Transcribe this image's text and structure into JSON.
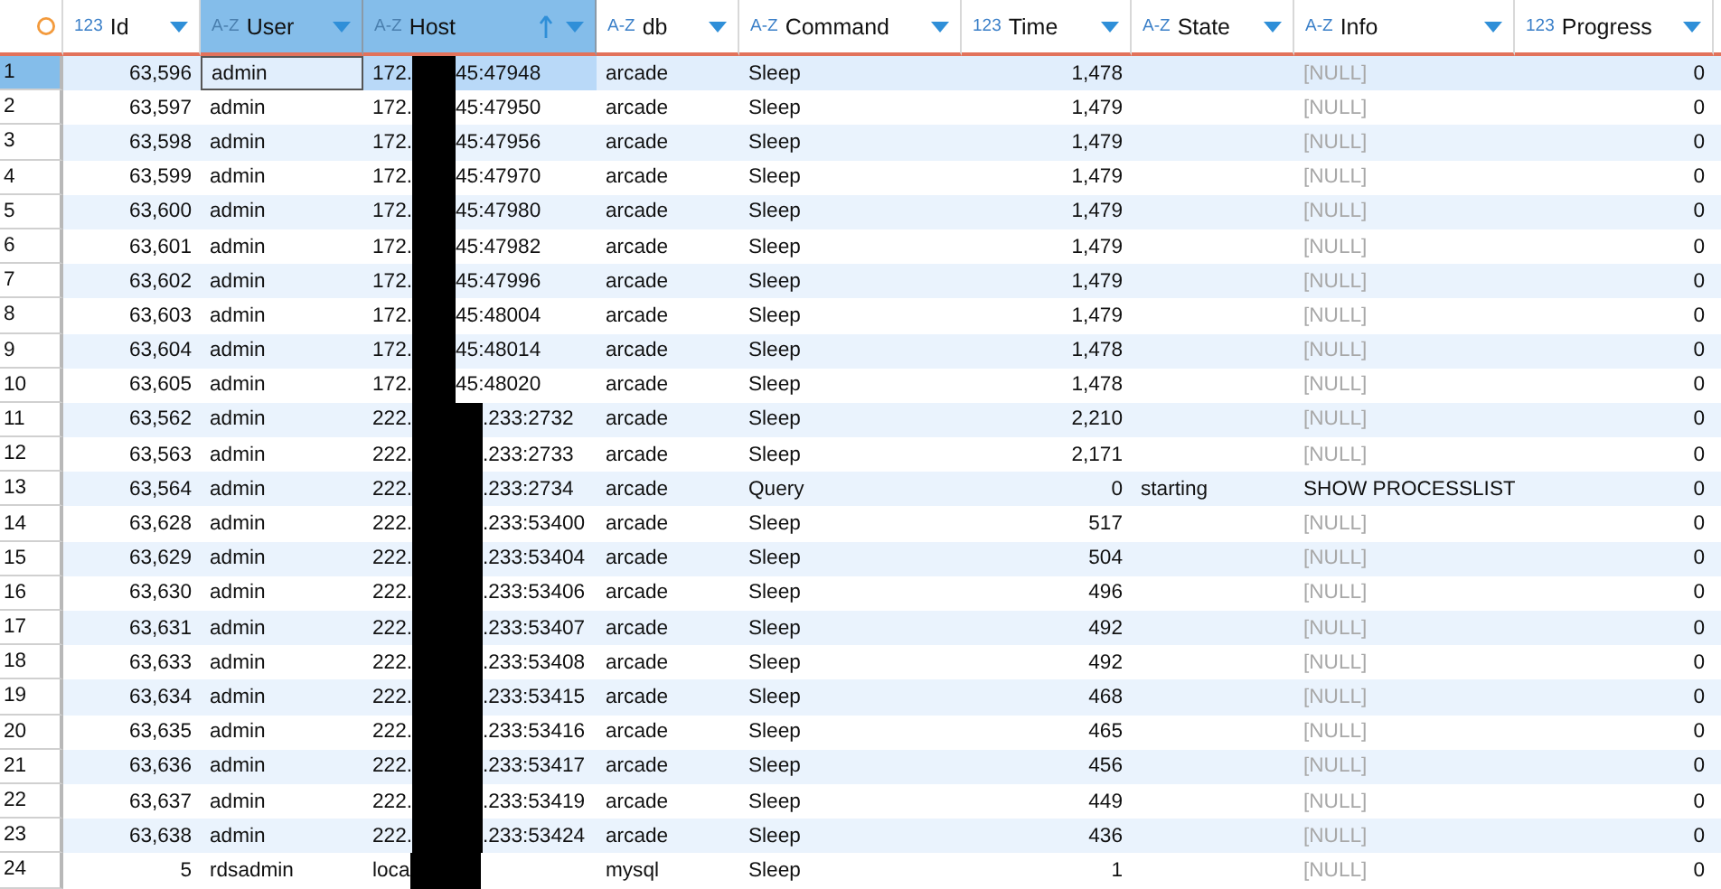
{
  "columns": [
    {
      "type_label": "123",
      "name": "Id",
      "selected": false,
      "sorted_ascending": false
    },
    {
      "type_label": "A-Z",
      "name": "User",
      "selected": true,
      "sorted_ascending": false
    },
    {
      "type_label": "A-Z",
      "name": "Host",
      "selected": true,
      "sorted_ascending": true
    },
    {
      "type_label": "A-Z",
      "name": "db",
      "selected": false,
      "sorted_ascending": false
    },
    {
      "type_label": "A-Z",
      "name": "Command",
      "selected": false,
      "sorted_ascending": false
    },
    {
      "type_label": "123",
      "name": "Time",
      "selected": false,
      "sorted_ascending": false
    },
    {
      "type_label": "A-Z",
      "name": "State",
      "selected": false,
      "sorted_ascending": false
    },
    {
      "type_label": "A-Z",
      "name": "Info",
      "selected": false,
      "sorted_ascending": false
    },
    {
      "type_label": "123",
      "name": "Progress",
      "selected": false,
      "sorted_ascending": false
    }
  ],
  "rows": [
    {
      "num": "1",
      "selected": true,
      "id": "63,596",
      "user": "admin",
      "host_start": "172.",
      "redacted_wide": false,
      "host_end": "45:47948",
      "db": "arcade",
      "command": "Sleep",
      "time": "1,478",
      "info": "[NULL]",
      "info_null": true,
      "progress": "0"
    },
    {
      "num": "2",
      "selected": false,
      "id": "63,597",
      "user": "admin",
      "host_start": "172.",
      "redacted_wide": false,
      "host_end": "45:47950",
      "db": "arcade",
      "command": "Sleep",
      "time": "1,479",
      "info": "[NULL]",
      "info_null": true,
      "progress": "0"
    },
    {
      "num": "3",
      "selected": false,
      "id": "63,598",
      "user": "admin",
      "host_start": "172.",
      "redacted_wide": false,
      "host_end": "45:47956",
      "db": "arcade",
      "command": "Sleep",
      "time": "1,479",
      "info": "[NULL]",
      "info_null": true,
      "progress": "0"
    },
    {
      "num": "4",
      "selected": false,
      "id": "63,599",
      "user": "admin",
      "host_start": "172.",
      "redacted_wide": false,
      "host_end": "45:47970",
      "db": "arcade",
      "command": "Sleep",
      "time": "1,479",
      "info": "[NULL]",
      "info_null": true,
      "progress": "0"
    },
    {
      "num": "5",
      "selected": false,
      "id": "63,600",
      "user": "admin",
      "host_start": "172.",
      "redacted_wide": false,
      "host_end": "45:47980",
      "db": "arcade",
      "command": "Sleep",
      "time": "1,479",
      "info": "[NULL]",
      "info_null": true,
      "progress": "0"
    },
    {
      "num": "6",
      "selected": false,
      "id": "63,601",
      "user": "admin",
      "host_start": "172.",
      "redacted_wide": false,
      "host_end": "45:47982",
      "db": "arcade",
      "command": "Sleep",
      "time": "1,479",
      "info": "[NULL]",
      "info_null": true,
      "progress": "0"
    },
    {
      "num": "7",
      "selected": false,
      "id": "63,602",
      "user": "admin",
      "host_start": "172.",
      "redacted_wide": false,
      "host_end": "45:47996",
      "db": "arcade",
      "command": "Sleep",
      "time": "1,479",
      "info": "[NULL]",
      "info_null": true,
      "progress": "0"
    },
    {
      "num": "8",
      "selected": false,
      "id": "63,603",
      "user": "admin",
      "host_start": "172.",
      "redacted_wide": false,
      "host_end": "45:48004",
      "db": "arcade",
      "command": "Sleep",
      "time": "1,479",
      "info": "[NULL]",
      "info_null": true,
      "progress": "0"
    },
    {
      "num": "9",
      "selected": false,
      "id": "63,604",
      "user": "admin",
      "host_start": "172.",
      "redacted_wide": false,
      "host_end": "45:48014",
      "db": "arcade",
      "command": "Sleep",
      "time": "1,478",
      "info": "[NULL]",
      "info_null": true,
      "progress": "0"
    },
    {
      "num": "10",
      "selected": false,
      "id": "63,605",
      "user": "admin",
      "host_start": "172.",
      "redacted_wide": false,
      "host_end": "45:48020",
      "db": "arcade",
      "command": "Sleep",
      "time": "1,478",
      "info": "[NULL]",
      "info_null": true,
      "progress": "0"
    },
    {
      "num": "11",
      "selected": false,
      "id": "63,562",
      "user": "admin",
      "host_start": "222.",
      "redacted_wide": true,
      "host_end": ".233:2732",
      "db": "arcade",
      "command": "Sleep",
      "time": "2,210",
      "info": "[NULL]",
      "info_null": true,
      "progress": "0"
    },
    {
      "num": "12",
      "selected": false,
      "id": "63,563",
      "user": "admin",
      "host_start": "222.",
      "redacted_wide": true,
      "host_end": ".233:2733",
      "db": "arcade",
      "command": "Sleep",
      "time": "2,171",
      "info": "[NULL]",
      "info_null": true,
      "progress": "0"
    },
    {
      "num": "13",
      "selected": false,
      "id": "63,564",
      "user": "admin",
      "host_start": "222.",
      "redacted_wide": true,
      "host_end": ".233:2734",
      "db": "arcade",
      "command": "Query",
      "time": "0",
      "state": "starting",
      "info": "SHOW PROCESSLIST",
      "info_null": false,
      "progress": "0"
    },
    {
      "num": "14",
      "selected": false,
      "id": "63,628",
      "user": "admin",
      "host_start": "222.",
      "redacted_wide": true,
      "host_end": ".233:53400",
      "db": "arcade",
      "command": "Sleep",
      "time": "517",
      "info": "[NULL]",
      "info_null": true,
      "progress": "0"
    },
    {
      "num": "15",
      "selected": false,
      "id": "63,629",
      "user": "admin",
      "host_start": "222.",
      "redacted_wide": true,
      "host_end": ".233:53404",
      "db": "arcade",
      "command": "Sleep",
      "time": "504",
      "info": "[NULL]",
      "info_null": true,
      "progress": "0"
    },
    {
      "num": "16",
      "selected": false,
      "id": "63,630",
      "user": "admin",
      "host_start": "222.",
      "redacted_wide": true,
      "host_end": ".233:53406",
      "db": "arcade",
      "command": "Sleep",
      "time": "496",
      "info": "[NULL]",
      "info_null": true,
      "progress": "0"
    },
    {
      "num": "17",
      "selected": false,
      "id": "63,631",
      "user": "admin",
      "host_start": "222.",
      "redacted_wide": true,
      "host_end": ".233:53407",
      "db": "arcade",
      "command": "Sleep",
      "time": "492",
      "info": "[NULL]",
      "info_null": true,
      "progress": "0"
    },
    {
      "num": "18",
      "selected": false,
      "id": "63,633",
      "user": "admin",
      "host_start": "222.",
      "redacted_wide": true,
      "host_end": ".233:53408",
      "db": "arcade",
      "command": "Sleep",
      "time": "492",
      "info": "[NULL]",
      "info_null": true,
      "progress": "0"
    },
    {
      "num": "19",
      "selected": false,
      "id": "63,634",
      "user": "admin",
      "host_start": "222.",
      "redacted_wide": true,
      "host_end": ".233:53415",
      "db": "arcade",
      "command": "Sleep",
      "time": "468",
      "info": "[NULL]",
      "info_null": true,
      "progress": "0"
    },
    {
      "num": "20",
      "selected": false,
      "id": "63,635",
      "user": "admin",
      "host_start": "222.",
      "redacted_wide": true,
      "host_end": ".233:53416",
      "db": "arcade",
      "command": "Sleep",
      "time": "465",
      "info": "[NULL]",
      "info_null": true,
      "progress": "0"
    },
    {
      "num": "21",
      "selected": false,
      "id": "63,636",
      "user": "admin",
      "host_start": "222.",
      "redacted_wide": true,
      "host_end": ".233:53417",
      "db": "arcade",
      "command": "Sleep",
      "time": "456",
      "info": "[NULL]",
      "info_null": true,
      "progress": "0"
    },
    {
      "num": "22",
      "selected": false,
      "id": "63,637",
      "user": "admin",
      "host_start": "222.",
      "redacted_wide": true,
      "host_end": ".233:53419",
      "db": "arcade",
      "command": "Sleep",
      "time": "449",
      "info": "[NULL]",
      "info_null": true,
      "progress": "0"
    },
    {
      "num": "23",
      "selected": false,
      "id": "63,638",
      "user": "admin",
      "host_start": "222.",
      "redacted_wide": true,
      "host_end": ".233:53424",
      "db": "arcade",
      "command": "Sleep",
      "time": "436",
      "info": "[NULL]",
      "info_null": true,
      "progress": "0"
    },
    {
      "num": "24",
      "selected": false,
      "id": "5",
      "user": "rdsadmin",
      "host_start": "loca",
      "redacted_wide": true,
      "db": "mysql",
      "command": "Sleep",
      "time": "1",
      "info": "[NULL]",
      "info_null": true,
      "progress": "0"
    }
  ]
}
